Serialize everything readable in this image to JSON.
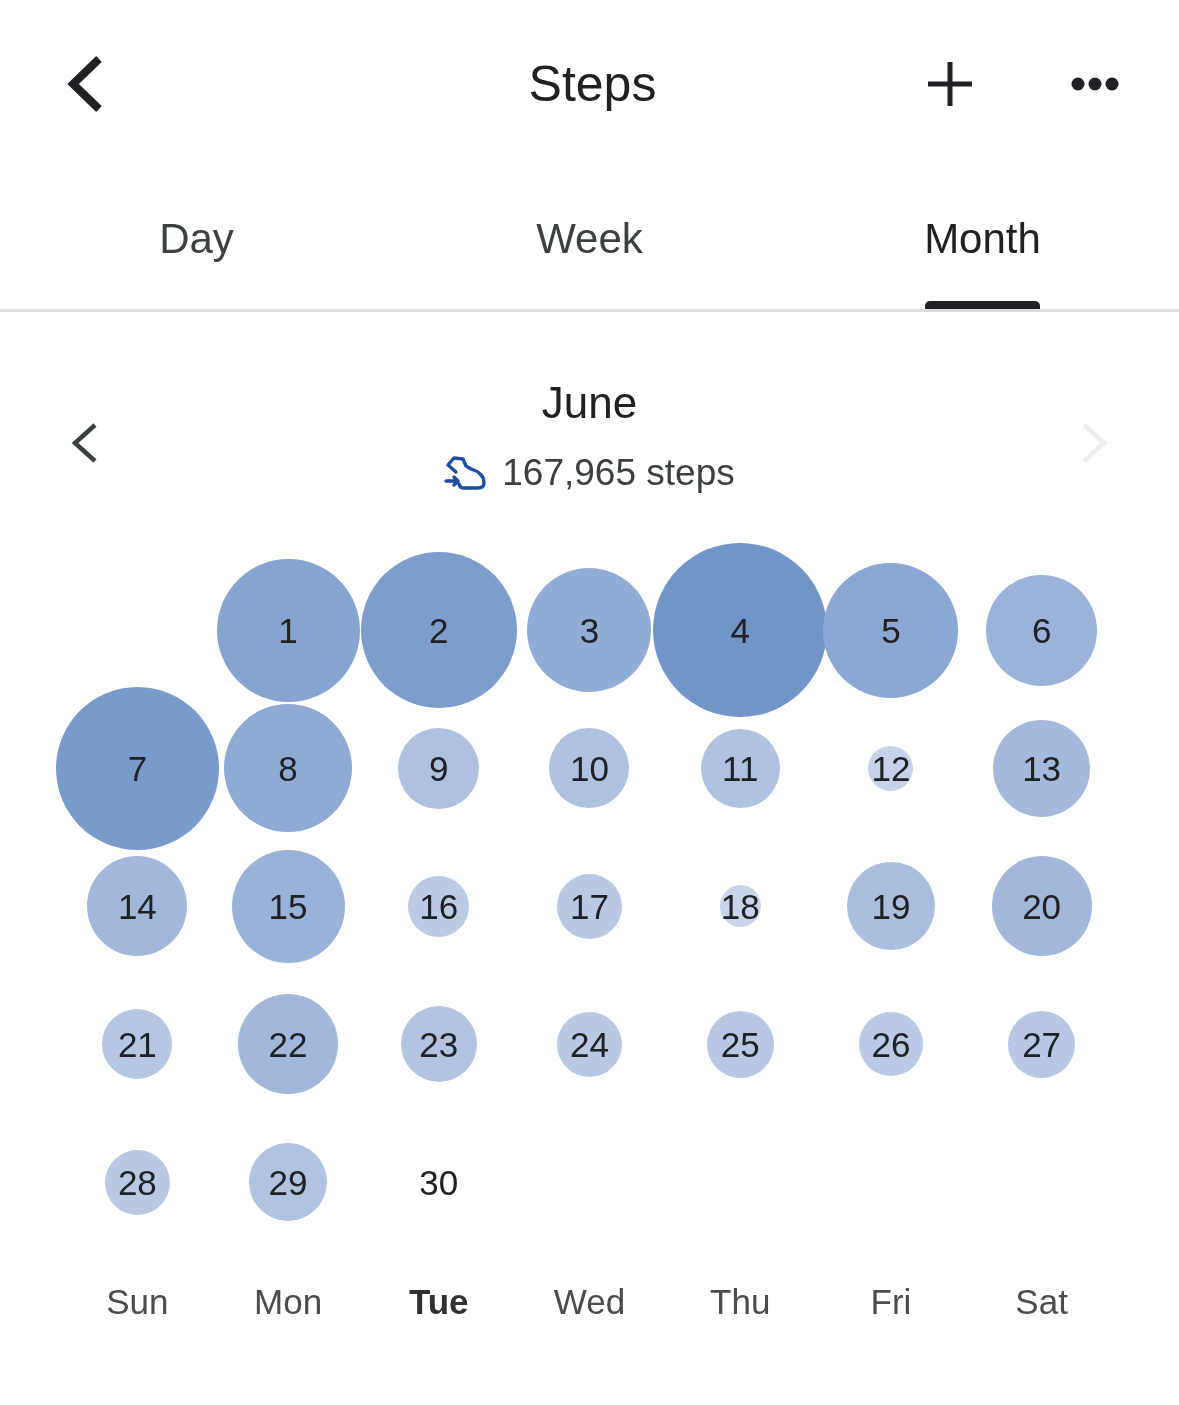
{
  "header": {
    "title": "Steps"
  },
  "tabs": [
    {
      "label": "Day",
      "selected": false
    },
    {
      "label": "Week",
      "selected": false
    },
    {
      "label": "Month",
      "selected": true
    }
  ],
  "period": {
    "title": "June",
    "total": "167,965 steps",
    "previous": {
      "disabled": false
    },
    "next": {
      "disabled": true
    }
  },
  "weeks": [
    {
      "days": [
        "1",
        "2",
        "3",
        "4",
        "5",
        "6"
      ]
    },
    {
      "days": [
        "7",
        "8",
        "9",
        "10",
        "11",
        "12",
        "13"
      ]
    },
    {
      "days": [
        "14",
        "15",
        "16",
        "17",
        "18",
        "19",
        "20"
      ]
    },
    {
      "days": [
        "21",
        "22",
        "23",
        "24",
        "25",
        "26",
        "27"
      ]
    },
    {
      "days": [
        "28",
        "29",
        "30"
      ]
    }
  ],
  "weekdays": [
    {
      "label": "Sun",
      "today": false
    },
    {
      "label": "Mon",
      "today": false
    },
    {
      "label": "Tue",
      "today": true
    },
    {
      "label": "Wed",
      "today": false
    },
    {
      "label": "Thu",
      "today": false
    },
    {
      "label": "Fri",
      "today": false
    },
    {
      "label": "Sat",
      "today": false
    }
  ]
}
